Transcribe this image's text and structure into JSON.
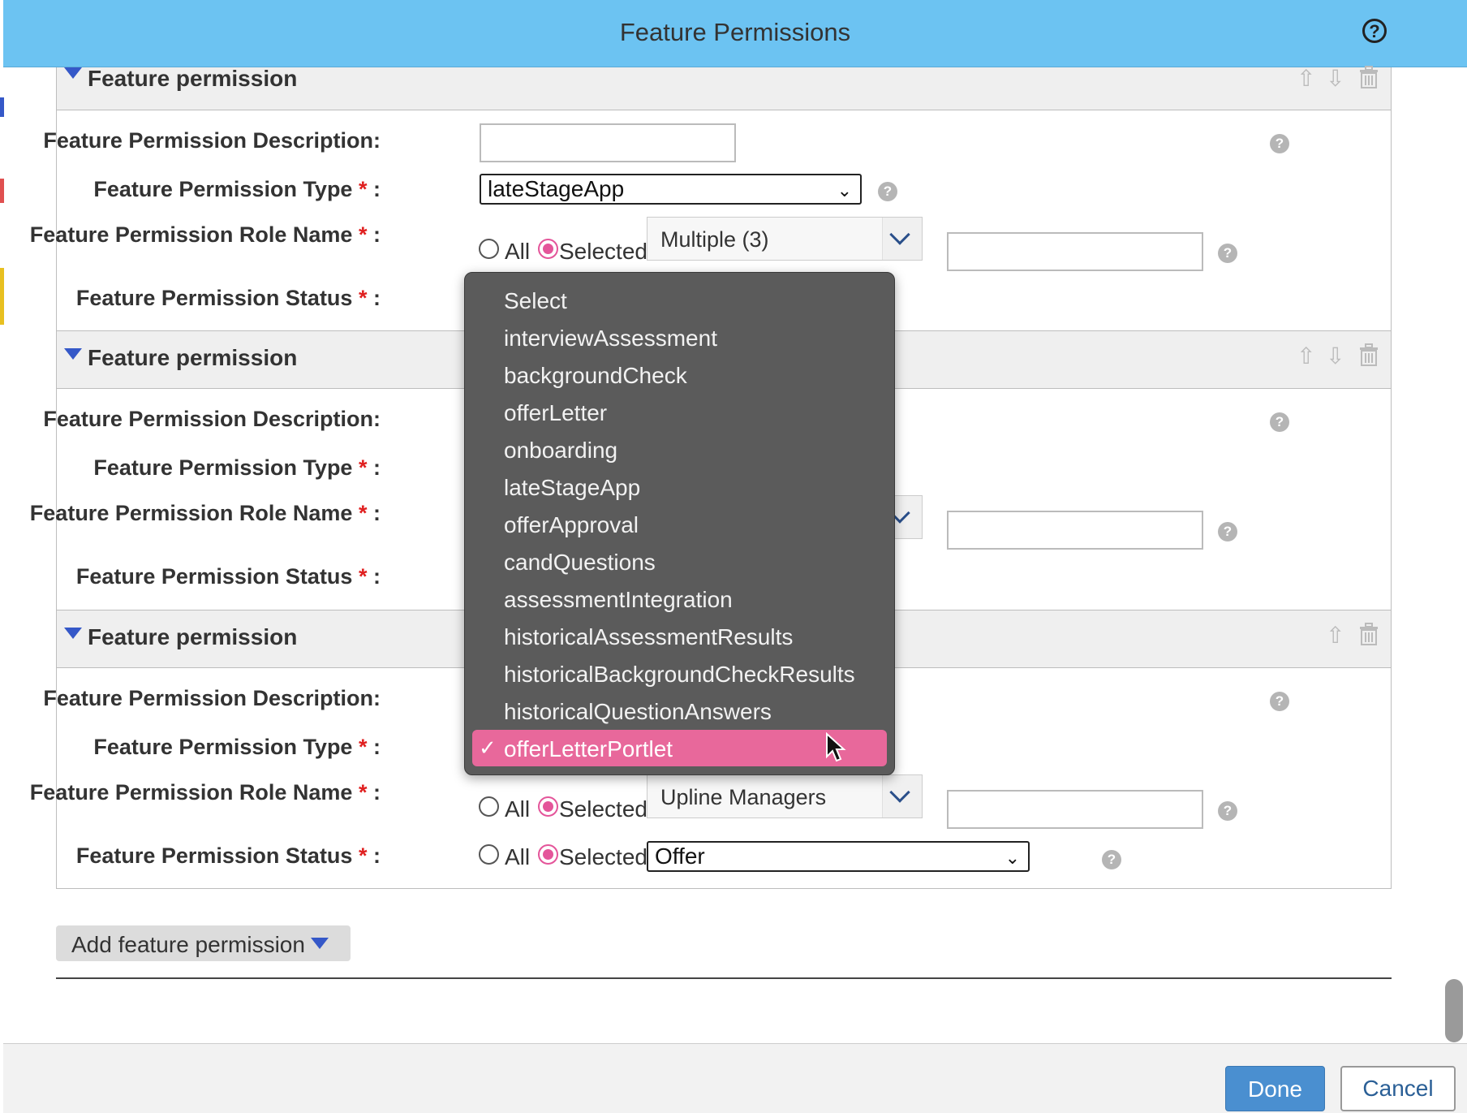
{
  "dialog": {
    "title": "Feature Permissions"
  },
  "labels": {
    "description": "Feature Permission Description:",
    "type": "Feature Permission Type",
    "role": "Feature Permission Role Name",
    "status": "Feature Permission Status",
    "required_mark": "*",
    "colon": ":"
  },
  "sections": [
    {
      "title": "Feature permission",
      "type_value": "lateStageApp",
      "role_value": "Multiple (3)",
      "status_value": ""
    },
    {
      "title": "Feature permission",
      "type_value": "",
      "role_value": "",
      "status_value": ""
    },
    {
      "title": "Feature permission",
      "type_value": "",
      "role_value": "Upline Managers",
      "status_value": "Offer"
    }
  ],
  "radio": {
    "all": "All",
    "selected": "Selected"
  },
  "dropdown": {
    "options": [
      "Select",
      "interviewAssessment",
      "backgroundCheck",
      "offerLetter",
      "onboarding",
      "lateStageApp",
      "offerApproval",
      "candQuestions",
      "assessmentIntegration",
      "historicalAssessmentResults",
      "historicalBackgroundCheckResults",
      "historicalQuestionAnswers",
      "offerLetterPortlet"
    ],
    "selected_index": 12,
    "check_mark": "✓"
  },
  "help_glyph": "?",
  "icons": {
    "move_up": "⇧",
    "move_down": "⇩",
    "delete": "trash-icon"
  },
  "add_button": {
    "label": "Add feature permission"
  },
  "footer": {
    "done": "Done",
    "cancel": "Cancel"
  },
  "colors": {
    "title_bar": "#6cc3f2",
    "accent_pink": "#e8689b",
    "primary_button": "#4a8fd0",
    "triangle_blue": "#3558c8"
  }
}
